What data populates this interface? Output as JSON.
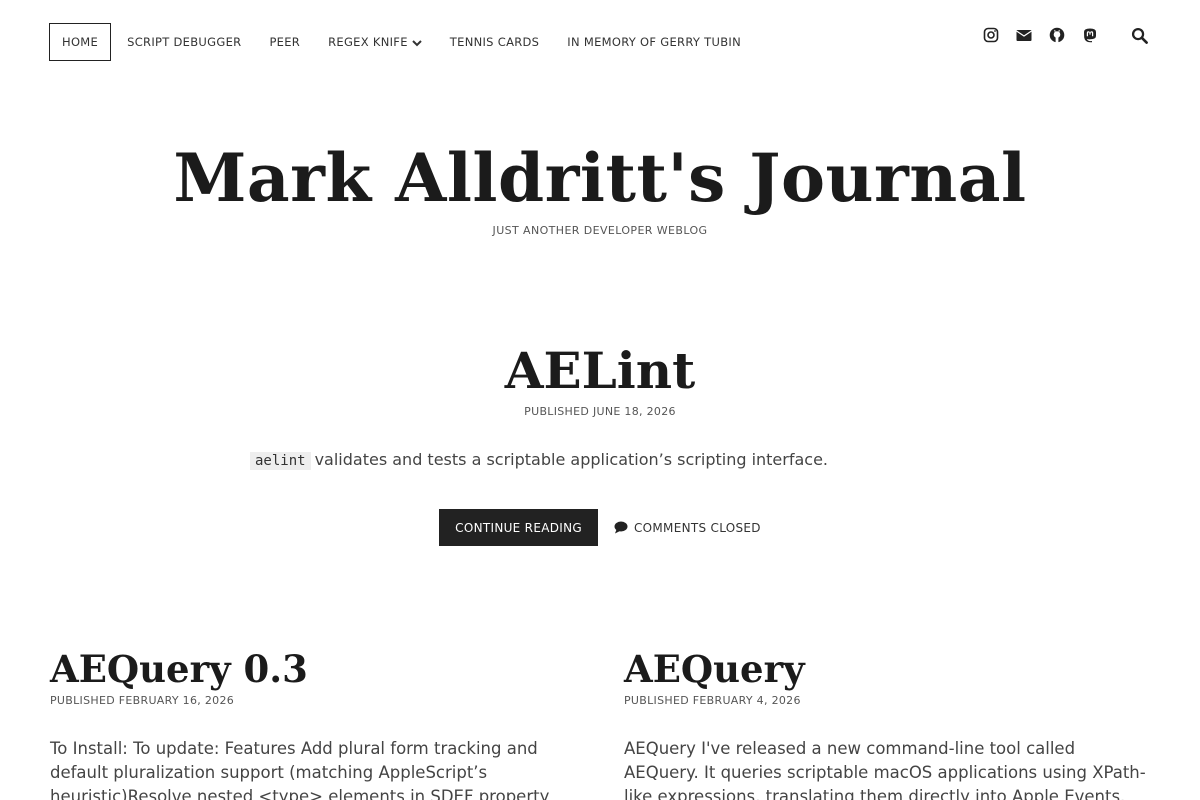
{
  "nav": {
    "items": [
      {
        "label": "HOME"
      },
      {
        "label": "SCRIPT DEBUGGER"
      },
      {
        "label": "PEER"
      },
      {
        "label": "REGEX KNIFE"
      },
      {
        "label": "TENNIS CARDS"
      },
      {
        "label": "IN MEMORY OF GERRY TUBIN"
      }
    ],
    "active_index": 0
  },
  "social": {
    "icons": [
      "instagram-icon",
      "envelope-icon",
      "github-icon",
      "mastodon-icon",
      "search-icon"
    ]
  },
  "site": {
    "title": "Mark Alldritt's Journal",
    "tagline": "JUST ANOTHER DEVELOPER WEBLOG"
  },
  "featured": {
    "title": "AELint",
    "meta": "PUBLISHED JUNE 18, 2026",
    "code": "aelint",
    "excerpt": "validates and tests a scriptable application’s scripting interface.",
    "continue_label": "CONTINUE READING",
    "comments_label": "COMMENTS CLOSED"
  },
  "posts": [
    {
      "title": "AEQuery 0.3",
      "meta": "PUBLISHED FEBRUARY 16, 2026",
      "excerpt": "To Install: To update: Features Add plural form tracking and default pluralization support (matching AppleScript’s heuristic)Resolve nested <type> elements in SDEF property parsingDecode"
    },
    {
      "title": "AEQuery",
      "meta": "PUBLISHED FEBRUARY 4, 2026",
      "excerpt": "AEQuery I've released a new command-line tool called AEQuery. It queries scriptable macOS applications using XPath-like expressions, translating them directly into Apple Events. The short"
    }
  ],
  "colors": {
    "text": "#222222",
    "muted": "#555555",
    "button_bg": "#222222",
    "button_text": "#ffffff",
    "code_bg": "#eeeeee"
  }
}
